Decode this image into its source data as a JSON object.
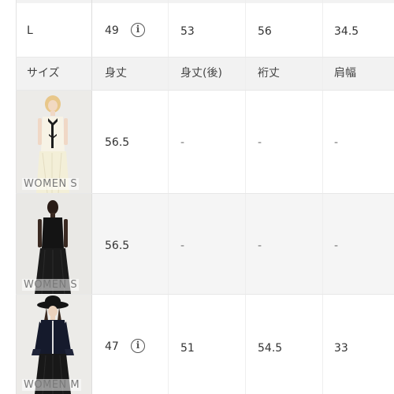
{
  "row_l": {
    "size": "L",
    "body_length": "49",
    "body_length_back": "53",
    "sleeve_length": "56",
    "shoulder_width": "34.5"
  },
  "header": {
    "size": "サイズ",
    "body_length": "身丈",
    "body_length_back": "身丈(後)",
    "sleeve_length": "裄丈",
    "shoulder_width": "肩幅"
  },
  "models": [
    {
      "label": "WOMEN S",
      "body_length": "56.5",
      "body_length_back": "-",
      "sleeve_length": "-",
      "shoulder_width": "-",
      "has_info_icon": false
    },
    {
      "label": "WOMEN S",
      "body_length": "56.5",
      "body_length_back": "-",
      "sleeve_length": "-",
      "shoulder_width": "-",
      "has_info_icon": false
    },
    {
      "label": "WOMEN M",
      "body_length": "47",
      "body_length_back": "51",
      "sleeve_length": "54.5",
      "shoulder_width": "33",
      "has_info_icon": true
    }
  ],
  "icons": {
    "info": "info-circle-icon"
  },
  "colors": {
    "header_bg": "#f2f2f2",
    "alt_row_bg": "#f5f5f5",
    "text": "#333333"
  }
}
